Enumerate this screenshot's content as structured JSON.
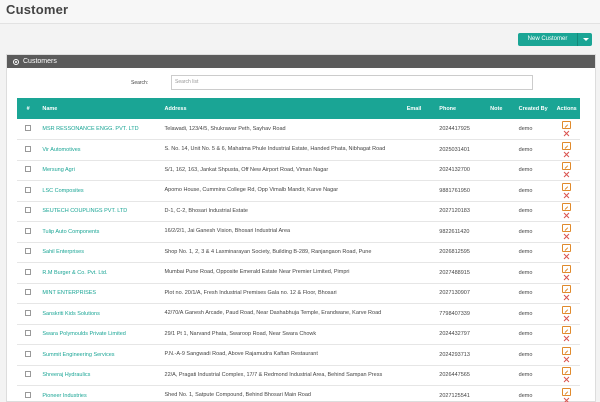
{
  "page": {
    "title": "Customer"
  },
  "toolbar": {
    "new_customer_label": "New Customer"
  },
  "panel": {
    "title": "Customers"
  },
  "search": {
    "label": "Search:",
    "value": "Search list"
  },
  "table": {
    "columns": [
      "#",
      "Name",
      "Address",
      "Email",
      "Phone",
      "Note",
      "Created By",
      "Actions"
    ],
    "rows": [
      {
        "name": "MSR RESSONANCE ENGG. PVT. LTD",
        "address": "Telawadi, 123/4/5, Shukrawar Peth, Sayhav Road",
        "email": "",
        "phone": "2024417925",
        "note": "",
        "created_by": "demo"
      },
      {
        "name": "Vir Automotives",
        "address": "S. No. 14, Unit No. 5 & 6, Mahatma Phule Industrial Estate, Handed Phata, Nibhagat Road",
        "email": "",
        "phone": "2025031401",
        "note": "",
        "created_by": "demo"
      },
      {
        "name": "Mersung Agri",
        "address": "S/1, 162, 163, Jankat Shpusta, Off New Airport Road, Viman Nagar",
        "email": "",
        "phone": "2024132700",
        "note": "",
        "created_by": "demo"
      },
      {
        "name": "LSC Composites",
        "address": "Apomo House, Cummins College Rd, Opp Vimalb Mandir, Karve Nagar",
        "email": "",
        "phone": "9881761950",
        "note": "",
        "created_by": "demo"
      },
      {
        "name": "SEUTECH COUPLINGS PVT. LTD",
        "address": "D-1, C-2, Bhosari Industrial Estate",
        "email": "",
        "phone": "2027120183",
        "note": "",
        "created_by": "demo"
      },
      {
        "name": "Tulip Auto Components",
        "address": "16/2/2/1, Jai Ganesh Vision, Bhosari Industrial Area",
        "email": "",
        "phone": "9822611420",
        "note": "",
        "created_by": "demo"
      },
      {
        "name": "Sahil Enterprises",
        "address": "Shop No. 1, 2, 3 & 4 Laxminarayan Society, Building B-289, Ranjangaon Road, Pune",
        "email": "",
        "phone": "2026812595",
        "note": "",
        "created_by": "demo"
      },
      {
        "name": "R.M Burger & Co. Pvt. Ltd.",
        "address": "Mumbai Pune Road, Opposite Emerald Estate Near Premier Limited, Pimpri",
        "email": "",
        "phone": "2027488915",
        "note": "",
        "created_by": "demo"
      },
      {
        "name": "MINT ENTERPRISES",
        "address": "Plot no. 20/1/A, Fresh Industrial Premises Gala no. 12 & Floor, Bhosari",
        "email": "",
        "phone": "2027130907",
        "note": "",
        "created_by": "demo"
      },
      {
        "name": "Sanskriti Kids Solutions",
        "address": "42/70/A Ganesh Arcade, Paud Road, Near Dashabhuja Temple, Erandwane, Karve Road",
        "email": "",
        "phone": "7798407339",
        "note": "",
        "created_by": "demo"
      },
      {
        "name": "Swara Polymoulds Private Limited",
        "address": "29/1 Pt 1, Narvand Phata, Swaroop Road, Near Swara Chowk",
        "email": "",
        "phone": "2024432797",
        "note": "",
        "created_by": "demo"
      },
      {
        "name": "Summit Engineering Services",
        "address": "P.N.-A-9 Sangwadi Road, Above Rajamudra Kaftan Restaurant",
        "email": "",
        "phone": "2024293713",
        "note": "",
        "created_by": "demo"
      },
      {
        "name": "Shreeraj Hydraulics",
        "address": "22/A, Pragati Industrial Complex, 17/7 & Redmond Industrial Area, Behind Sampan Press",
        "email": "",
        "phone": "2026447565",
        "note": "",
        "created_by": "demo"
      },
      {
        "name": "Pioneer Industries",
        "address": "Shed No. 1, Satpute Compound, Behind Bhosari Main Road",
        "email": "",
        "phone": "2027125541",
        "note": "",
        "created_by": "demo"
      }
    ]
  },
  "colors": {
    "accent": "#1aa595",
    "panel_header": "#5b5b5b",
    "edit": "#e08a2c",
    "delete": "#d9534f"
  }
}
